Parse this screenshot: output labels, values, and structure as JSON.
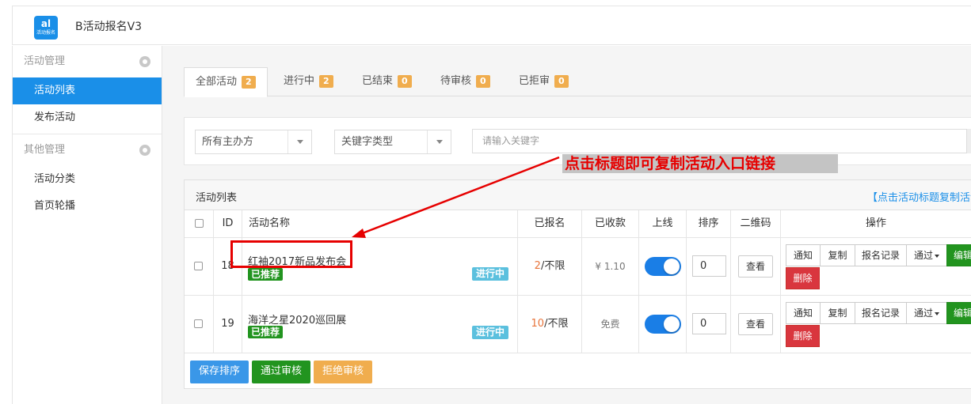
{
  "app": {
    "title": "B活动报名V3",
    "logo_main": "al",
    "logo_sub": "活动报名"
  },
  "sidebar": {
    "groups": [
      {
        "label": "活动管理",
        "icon": "gear-icon",
        "items": [
          {
            "label": "活动列表",
            "active": true
          },
          {
            "label": "发布活动",
            "active": false
          }
        ]
      },
      {
        "label": "其他管理",
        "icon": "gear-icon",
        "items": [
          {
            "label": "活动分类",
            "active": false
          },
          {
            "label": "首页轮播",
            "active": false
          }
        ]
      }
    ]
  },
  "tabs": [
    {
      "label": "全部活动",
      "count": "2",
      "active": true
    },
    {
      "label": "进行中",
      "count": "2",
      "active": false
    },
    {
      "label": "已结束",
      "count": "0",
      "active": false
    },
    {
      "label": "待审核",
      "count": "0",
      "active": false
    },
    {
      "label": "已拒审",
      "count": "0",
      "active": false
    }
  ],
  "filter": {
    "organizer": "所有主办方",
    "keyword_type": "关键字类型",
    "keyword_placeholder": "请输入关键字"
  },
  "annotation": {
    "text": "点击标题即可复制活动入口链接"
  },
  "list": {
    "title": "活动列表",
    "hint": "【点击活动标题复制活动入口链接】",
    "columns": {
      "id": "ID",
      "name": "活动名称",
      "signed": "已报名",
      "paid": "已收款",
      "online": "上线",
      "sort": "排序",
      "qrcode": "二维码",
      "actions": "操作"
    },
    "rows": [
      {
        "id": "18",
        "name": "红袖2017新品发布会",
        "recommended": "已推荐",
        "status": "进行中",
        "signed_num": "2",
        "signed_limit": "/不限",
        "paid": "¥ 1.10",
        "online": true,
        "sort": "0",
        "qr_btn": "查看"
      },
      {
        "id": "19",
        "name": "海洋之星2020巡回展",
        "recommended": "已推荐",
        "status": "进行中",
        "signed_num": "10",
        "signed_limit": "/不限",
        "paid": "免费",
        "online": true,
        "sort": "0",
        "qr_btn": "查看"
      }
    ],
    "row_actions": {
      "notify": "通知",
      "copy": "复制",
      "records": "报名记录",
      "approve": "通过",
      "edit": "编辑",
      "delete": "删除"
    }
  },
  "footer": {
    "save_sort": "保存排序",
    "approve": "通过审核",
    "reject": "拒绝审核"
  },
  "colors": {
    "primary": "#1a8fe8",
    "success": "#22941f",
    "warning": "#f0ad4e",
    "danger": "#d9363e",
    "info": "#5bc0de",
    "annotation": "#e60000"
  }
}
